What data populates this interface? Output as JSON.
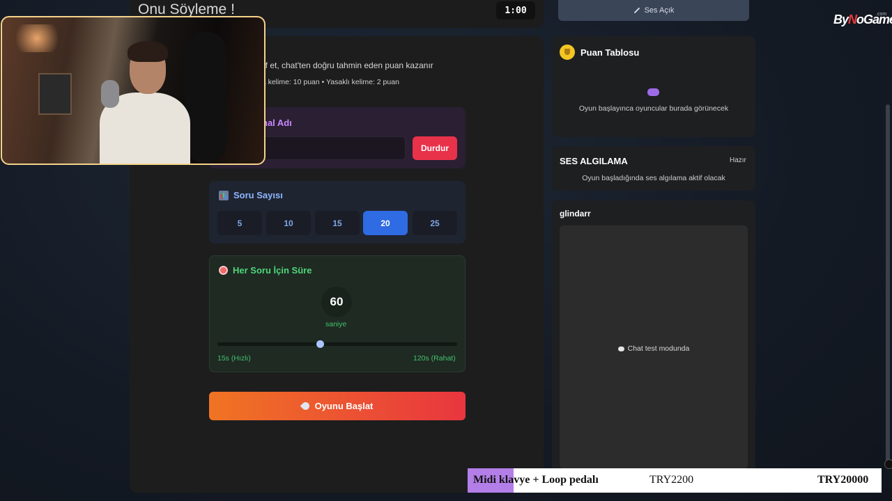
{
  "header": {
    "title": "Onu Söyleme !",
    "timer": "1:00"
  },
  "intro": {
    "line1": "rif et, chat'ten doğru tahmin eden puan kazanır",
    "line2": "na kelime: 10 puan • Yasaklı kelime: 2 puan"
  },
  "channel": {
    "label": "nal Adı",
    "value": "",
    "stop_label": "Durdur"
  },
  "question_count": {
    "title": "Soru Sayısı",
    "options": [
      "5",
      "10",
      "15",
      "20",
      "25"
    ],
    "selected": "20"
  },
  "time_per_question": {
    "title": "Her Soru İçin Süre",
    "value": "60",
    "unit": "saniye",
    "min_label": "15s (Hızlı)",
    "max_label": "120s (Rahat)",
    "slider_fraction": 0.43
  },
  "start_button": {
    "label": "Oyunu Başlat"
  },
  "sound_button": {
    "label": "Ses Açık"
  },
  "scoreboard": {
    "title": "Puan Tablosu",
    "empty_text": "Oyun başlayınca oyuncular burada görünecek"
  },
  "voice_detection": {
    "title": "SES ALGILAMA",
    "status": "Hazır",
    "description": "Oyun başladığında ses algılama aktif olacak"
  },
  "chat": {
    "username": "glindarr",
    "message": "Chat test modunda"
  },
  "overlay": {
    "logo_main": "By",
    "logo_n": "N",
    "logo_rest": "oGame",
    "logo_suffix": ".com",
    "ticker_item": "Midi klavye + Loop pedalı",
    "ticker_price1": "TRY2200",
    "ticker_price2": "TRY20000"
  },
  "colors": {
    "accent_blue": "#2f6be3",
    "stop_red": "#e8324a",
    "green": "#4fd67c",
    "purple": "#c987ff",
    "start_gradient_start": "#f07423",
    "start_gradient_end": "#e8363f"
  }
}
